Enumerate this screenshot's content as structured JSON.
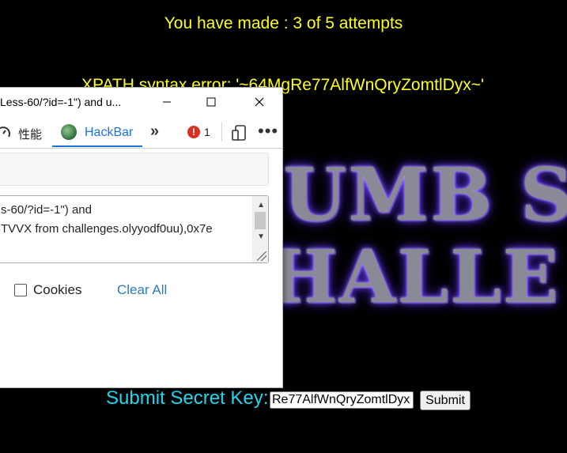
{
  "page": {
    "attempts_text": "You have made : 3 of 5 attempts",
    "error_text": "XPATH syntax error: '~64MgRe77AlfWnQryZomtlDyx~'",
    "banner": {
      "line1": "UMB S",
      "line2": "HALLE"
    },
    "submit_label": "Submit Secret Key:",
    "secret_value": "Re77AlfWnQryZomtlDyx",
    "submit_button": "Submit",
    "colors": {
      "attempts": "#ffff1a",
      "submit_label": "#1ed8f0",
      "background": "#000000"
    }
  },
  "devtools": {
    "title": "Less-60/?id=-1\") and u...",
    "tabs": {
      "performance": "性能",
      "hackbar": "HackBar"
    },
    "error_badge": "!",
    "error_count": "1",
    "url_value": "",
    "post_line1": "s-60/?id=-1\") and",
    "post_line2": "TVVX from challenges.olyyodf0uu),0x7e",
    "cookies_label": "Cookies",
    "clear_all_label": "Clear All",
    "colors": {
      "active_tab": "#1a73e8",
      "clear_all": "#2b7bb9"
    }
  }
}
